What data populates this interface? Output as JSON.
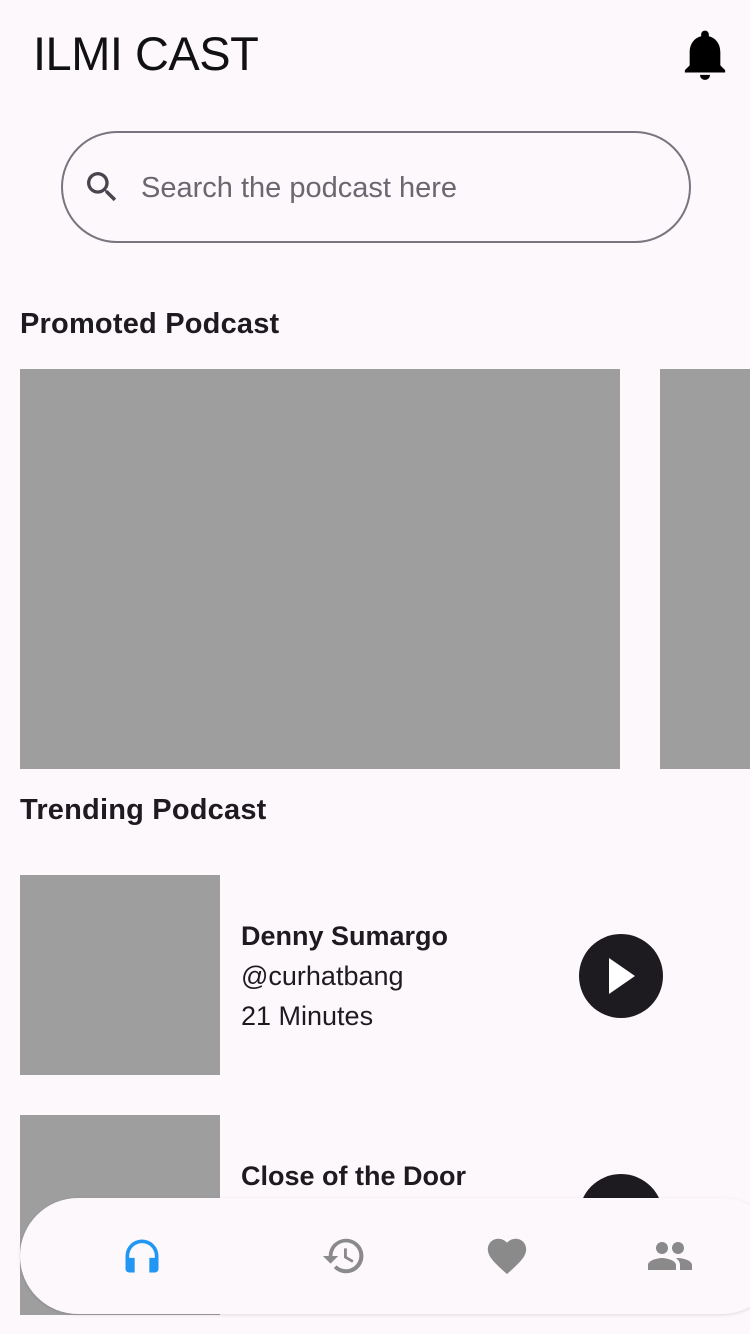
{
  "header": {
    "title": "ILMI CAST",
    "bell_icon": "notifications-bell-icon"
  },
  "search": {
    "placeholder": "Search the podcast here",
    "value": "",
    "icon": "search-icon"
  },
  "promoted": {
    "title": "Promoted Podcast"
  },
  "trending": {
    "title": "Trending Podcast",
    "items": [
      {
        "title": "Denny Sumargo",
        "handle": "@curhatbang",
        "duration": "21 Minutes"
      },
      {
        "title": "Close of the Door"
      }
    ]
  },
  "bottom_nav": {
    "items": [
      {
        "name": "podcast",
        "icon": "headphones-icon",
        "active": true
      },
      {
        "name": "history",
        "icon": "history-icon",
        "active": false
      },
      {
        "name": "favorite",
        "icon": "heart-icon",
        "active": false
      },
      {
        "name": "community",
        "icon": "people-icon",
        "active": false
      }
    ]
  },
  "colors": {
    "background": "#fdf8fc",
    "accent": "#2196f3",
    "placeholder_gray": "#9e9e9e",
    "inactive_icon": "#8a8a8a",
    "dark": "#1d1b20"
  }
}
